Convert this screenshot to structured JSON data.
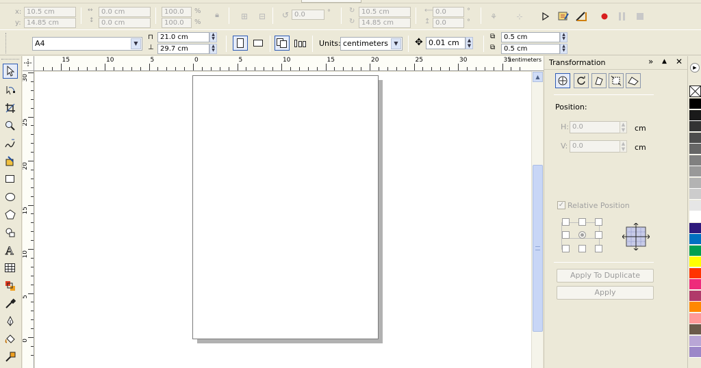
{
  "row1": {
    "x_label": "x:",
    "x_value": "10.5 cm",
    "y_label": "y:",
    "y_value": "14.85 cm",
    "w_value": "0.0 cm",
    "h_value": "0.0 cm",
    "sx_value": "100.0",
    "sy_value": "100.0",
    "pct": "%",
    "angle_value": "0.0",
    "deg": "°",
    "cx_value": "10.5 cm",
    "cy_value": "14.85 cm",
    "rx_value": "0.0",
    "ry_value": "0.0"
  },
  "row2": {
    "paper_size": "A4",
    "page_width": "21.0 cm",
    "page_height": "29.7 cm",
    "units_label": "Units:",
    "units_value": "centimeters",
    "nudge_value": "0.01 cm",
    "dup_x": "0.5 cm",
    "dup_y": "0.5 cm"
  },
  "ruler": {
    "unit": "centimeters",
    "h_ticks": [
      "15",
      "10",
      "5",
      "0",
      "5",
      "10",
      "15",
      "20",
      "25",
      "30",
      "35"
    ],
    "v_ticks": [
      "30",
      "25",
      "20",
      "15",
      "10",
      "5",
      "0"
    ]
  },
  "panel": {
    "title": "Transformation",
    "position_label": "Position:",
    "h_label": "H:",
    "h_value": "0.0",
    "h_unit": "cm",
    "v_label": "V:",
    "v_value": "0.0",
    "v_unit": "cm",
    "relative_position": "Relative Position",
    "apply_duplicate": "Apply To Duplicate",
    "apply": "Apply"
  },
  "palette": [
    "#000000",
    "#1a1a1a",
    "#333333",
    "#4d4d4d",
    "#666666",
    "#808080",
    "#999999",
    "#b3b3b3",
    "#cccccc",
    "#e6e6e6",
    "#ffffff",
    "#2e1a7c",
    "#0070c0",
    "#00a050",
    "#ffff00",
    "#ff3300",
    "#ee2a7b",
    "#b03a6a",
    "#ff8800",
    "#ff9999",
    "#6b5a4a",
    "#b9a6d6",
    "#9c87c8"
  ]
}
